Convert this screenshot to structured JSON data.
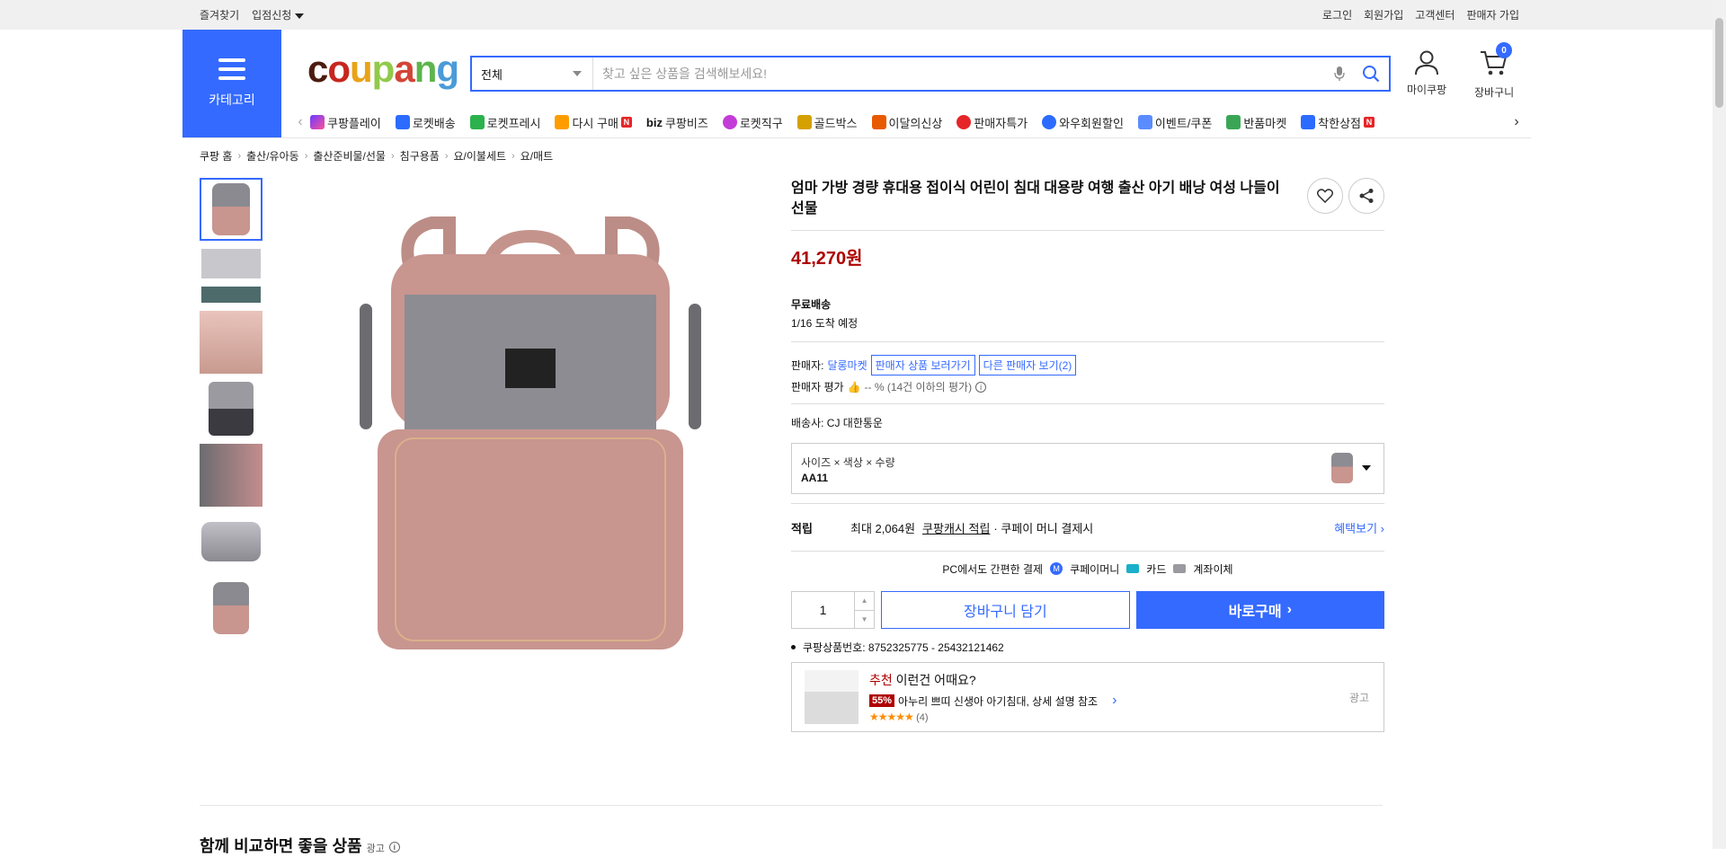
{
  "topbar": {
    "bookmark": "즐겨찾기",
    "partner": "입점신청",
    "login": "로그인",
    "signup": "회원가입",
    "cs": "고객센터",
    "seller_join": "판매자 가입"
  },
  "header": {
    "category_label": "카테고리",
    "logo": "coupang",
    "search_scope": "전체",
    "search_placeholder": "찾고 싶은 상품을 검색해보세요!",
    "mypage_label": "마이쿠팡",
    "cart_label": "장바구니",
    "cart_count": "0"
  },
  "nav": [
    {
      "label": "쿠팡플레이",
      "icon": "play-icon",
      "color": "#6a3cff"
    },
    {
      "label": "로켓배송",
      "icon": "rocket-icon",
      "color": "#2b6cff"
    },
    {
      "label": "로켓프레시",
      "icon": "rocket-fresh-icon",
      "color": "#2bb24c"
    },
    {
      "label": "다시 구매",
      "icon": "rebuy-icon",
      "color": "#ff9d00"
    },
    {
      "label": "쿠팡비즈",
      "icon": "biz-icon",
      "color": "#000000"
    },
    {
      "label": "로켓직구",
      "icon": "global-icon",
      "color": "#c43cd7"
    },
    {
      "label": "골드박스",
      "icon": "goldbox-icon",
      "color": "#d4a100"
    },
    {
      "label": "이달의신상",
      "icon": "new-icon",
      "color": "#e85a00"
    },
    {
      "label": "판매자특가",
      "icon": "discount-icon",
      "color": "#e52528"
    },
    {
      "label": "와우회원할인",
      "icon": "wow-icon",
      "color": "#2b6cff"
    },
    {
      "label": "이벤트/쿠폰",
      "icon": "coupon-icon",
      "color": "#2b6cff"
    },
    {
      "label": "반품마켓",
      "icon": "return-market-icon",
      "color": "#3aa655"
    },
    {
      "label": "착한상점",
      "icon": "good-shop-icon",
      "color": "#2b6cff"
    }
  ],
  "breadcrumb": [
    "쿠팡 홈",
    "출산/유아동",
    "출산준비물/선물",
    "침구용품",
    "요/이불세트",
    "요/매트"
  ],
  "product": {
    "title": "엄마 가방 경량 휴대용 접이식 어린이 침대 대용량 여행 출산 아기 배낭 여성 나들이 선물",
    "price": "41,270원",
    "shipping_title": "무료배송",
    "shipping_eta": "1/16 도착 예정",
    "seller_prefix": "판매자:",
    "seller_name": "달롱마켓",
    "seller_products_btn": "판매자 상품 보러가기",
    "other_sellers_btn": "다른 판매자 보기(2)",
    "seller_rating_label": "판매자 평가",
    "seller_rating_value": "-- % (14건 이하의 평가)",
    "carrier": "배송사:  CJ 대한통운",
    "option_label": "사이즈 × 색상 × 수량",
    "option_value": "AA11",
    "reward_label": "적립",
    "reward_text": "최대 2,064원",
    "reward_link": "쿠팡캐시 적립",
    "reward_suffix": "· 쿠페이 머니 결제시",
    "benefit_link": "혜택보기",
    "pay_title": "PC에서도 간편한 결제",
    "pay_money": "쿠페이머니",
    "pay_card": "카드",
    "pay_bank": "계좌이체",
    "qty": "1",
    "cart_btn": "장바구니 담기",
    "buy_btn": "바로구매",
    "product_id": "쿠팡상품번호: 8752325775 - 25432121462"
  },
  "recommend": {
    "prefix": "추천",
    "title": "이런건 어때요?",
    "discount": "55%",
    "name": "아누리 쁘띠 신생아 아기침대, 상세 설명 참조",
    "stars": "★★★★★",
    "reviews": "(4)",
    "ad_label": "광고"
  },
  "section": {
    "title": "함께 비교하면 좋을 상품",
    "ad": "광고"
  },
  "colors": {
    "accent": "#346aff",
    "price": "#ae0000"
  }
}
